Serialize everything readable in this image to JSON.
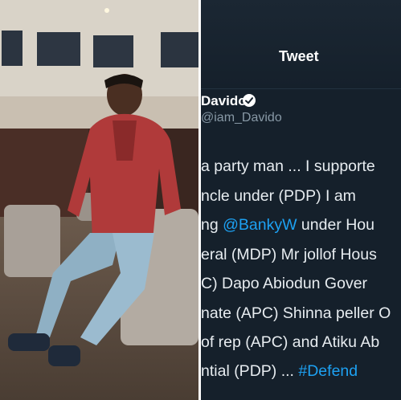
{
  "tweet": {
    "title": "Tweet",
    "author_name": "Davido",
    "handle": "@iam_Davido",
    "lines": [
      {
        "pre": "a party man ... I supporte",
        "link": "",
        "post": ""
      },
      {
        "pre": "ncle under (PDP) I am",
        "link": "",
        "post": ""
      },
      {
        "pre": "ng ",
        "link": "@BankyW",
        "post": " under Hou"
      },
      {
        "pre": "eral (MDP) Mr jollof  Hous",
        "link": "",
        "post": ""
      },
      {
        "pre": "C)  Dapo Abiodun Gover",
        "link": "",
        "post": ""
      },
      {
        "pre": "nate (APC) Shinna peller O",
        "link": "",
        "post": ""
      },
      {
        "pre": "of rep (APC) and Atiku Ab",
        "link": "",
        "post": ""
      },
      {
        "pre": "ntial (PDP) ... ",
        "link": "#Defend",
        "post": ""
      }
    ]
  },
  "colors": {
    "tweet_bg": "#15202b",
    "link": "#1da1f2",
    "muted": "#8899a6"
  }
}
